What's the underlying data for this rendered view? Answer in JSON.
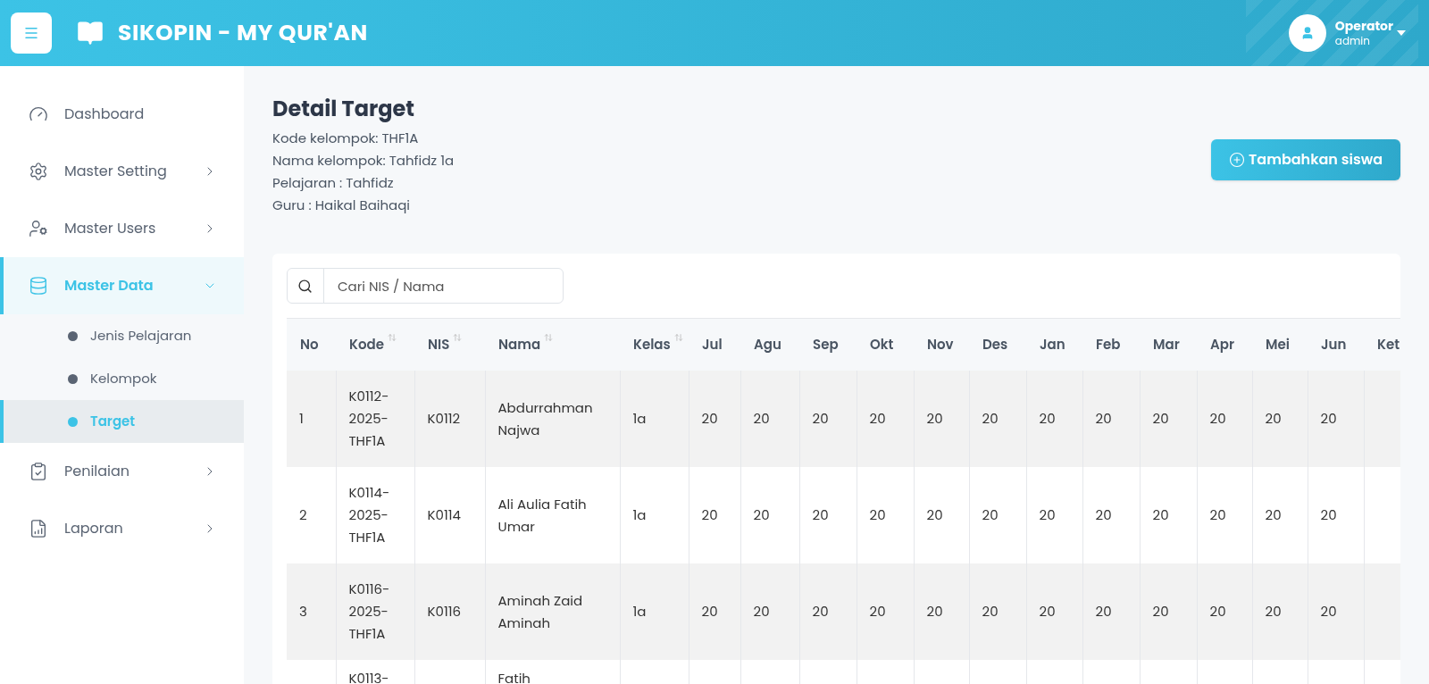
{
  "header": {
    "title": "SIKOPIN - MY QUR'AN",
    "user": {
      "name": "Operator",
      "role": "admin"
    }
  },
  "sidebar": {
    "items": [
      {
        "kind": "dashboard",
        "label": "Dashboard",
        "selected": false
      },
      {
        "kind": "setting",
        "label": "Master Setting",
        "selected": false,
        "expanded": false
      },
      {
        "kind": "users",
        "label": "Master Users",
        "selected": false,
        "expanded": false
      },
      {
        "kind": "data",
        "label": "Master Data",
        "selected": true,
        "expanded": true,
        "children": [
          {
            "label": "Jenis Pelajaran",
            "selected": false
          },
          {
            "label": "Kelompok",
            "selected": false
          },
          {
            "label": "Target",
            "selected": true
          }
        ]
      },
      {
        "kind": "penilaian",
        "label": "Penilaian",
        "selected": false,
        "expanded": false
      },
      {
        "kind": "laporan",
        "label": "Laporan",
        "selected": false,
        "expanded": false
      }
    ]
  },
  "page": {
    "title": "Detail Target",
    "details": [
      "Kode kelompok: THF1A",
      "Nama kelompok: Tahfidz 1a",
      "Pelajaran : Tahfidz",
      "Guru : Haikal Baihaqi"
    ],
    "add_button": "Tambahkan siswa"
  },
  "search": {
    "placeholder": "Cari NIS / Nama"
  },
  "table": {
    "columns": [
      {
        "label": "No",
        "sortable": false
      },
      {
        "label": "Kode",
        "sortable": true
      },
      {
        "label": "NIS",
        "sortable": true
      },
      {
        "label": "Nama",
        "sortable": true
      },
      {
        "label": "Kelas",
        "sortable": true
      },
      {
        "label": "Jul",
        "sortable": false
      },
      {
        "label": "Agu",
        "sortable": false
      },
      {
        "label": "Sep",
        "sortable": false
      },
      {
        "label": "Okt",
        "sortable": false
      },
      {
        "label": "Nov",
        "sortable": false
      },
      {
        "label": "Des",
        "sortable": false
      },
      {
        "label": "Jan",
        "sortable": false
      },
      {
        "label": "Feb",
        "sortable": false
      },
      {
        "label": "Mar",
        "sortable": false
      },
      {
        "label": "Apr",
        "sortable": false
      },
      {
        "label": "Mei",
        "sortable": false
      },
      {
        "label": "Jun",
        "sortable": false
      },
      {
        "label": "Ket",
        "sortable": false
      }
    ],
    "rows": [
      [
        "1",
        "K0112-2025-THF1A",
        "K0112",
        "Abdurrahman Najwa",
        "1a",
        "20",
        "20",
        "20",
        "20",
        "20",
        "20",
        "20",
        "20",
        "20",
        "20",
        "20",
        "20",
        ""
      ],
      [
        "2",
        "K0114-2025-THF1A",
        "K0114",
        "Ali Aulia Fatih Umar",
        "1a",
        "20",
        "20",
        "20",
        "20",
        "20",
        "20",
        "20",
        "20",
        "20",
        "20",
        "20",
        "20",
        ""
      ],
      [
        "3",
        "K0116-2025-THF1A",
        "K0116",
        "Aminah Zaid Aminah",
        "1a",
        "20",
        "20",
        "20",
        "20",
        "20",
        "20",
        "20",
        "20",
        "20",
        "20",
        "20",
        "20",
        ""
      ],
      [
        "",
        "K0113-",
        "",
        "Fatih",
        "",
        "",
        "",
        "",
        "",
        "",
        "",
        "",
        "",
        "",
        "",
        "",
        "",
        ""
      ]
    ]
  }
}
